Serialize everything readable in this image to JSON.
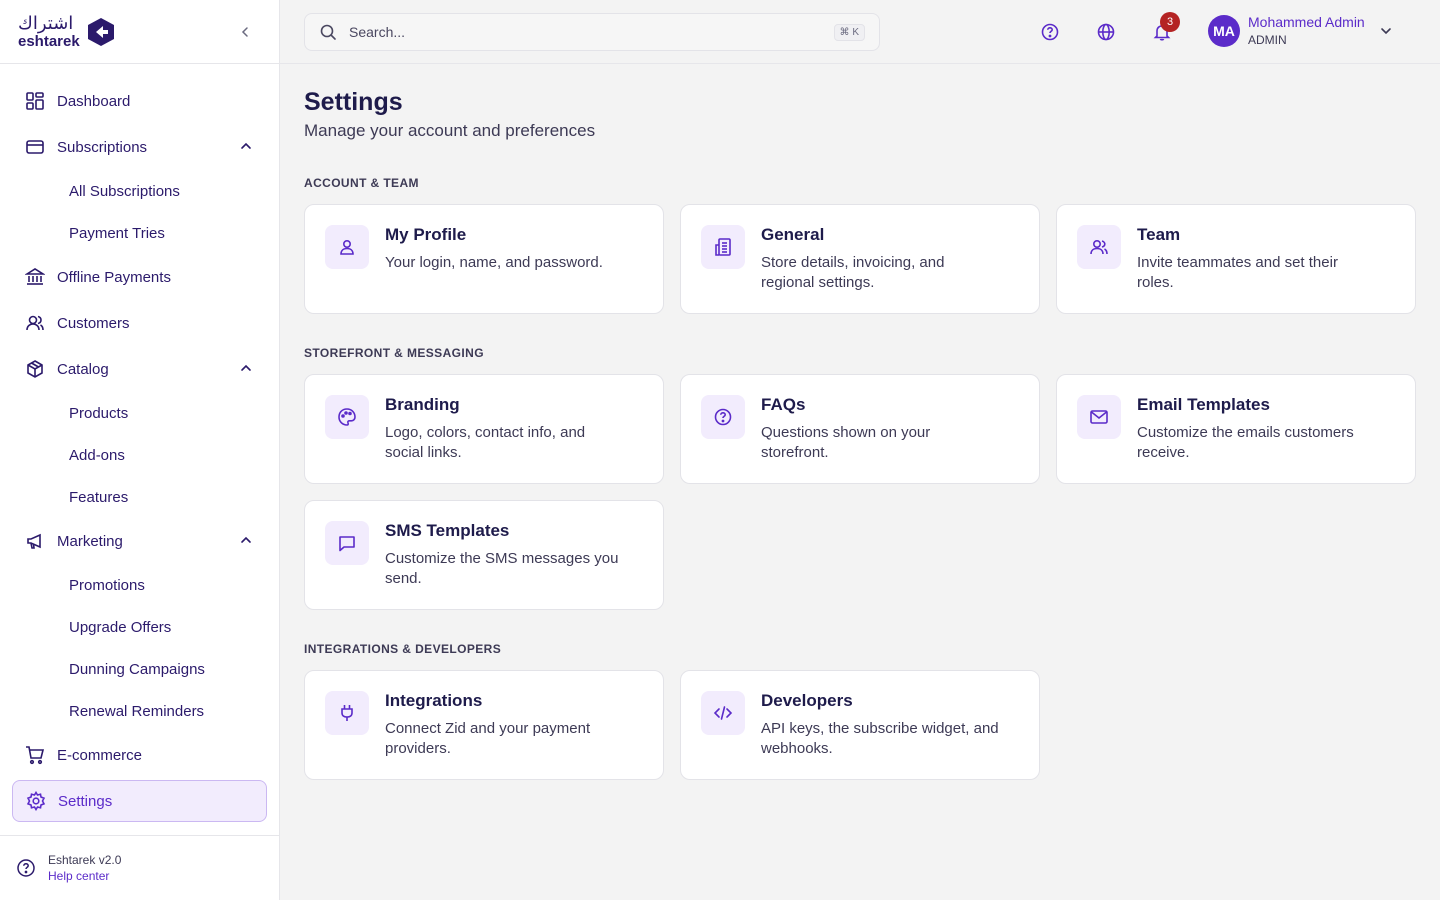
{
  "brand": {
    "name_ar": "اشتراك",
    "name_en": "eshtarek"
  },
  "sidebar": {
    "items": [
      {
        "label": "Dashboard"
      },
      {
        "label": "Subscriptions",
        "children": [
          "All Subscriptions",
          "Payment Tries"
        ]
      },
      {
        "label": "Offline Payments"
      },
      {
        "label": "Customers"
      },
      {
        "label": "Catalog",
        "children": [
          "Products",
          "Add-ons",
          "Features"
        ]
      },
      {
        "label": "Marketing",
        "children": [
          "Promotions",
          "Upgrade Offers",
          "Dunning Campaigns",
          "Renewal Reminders"
        ]
      },
      {
        "label": "E-commerce"
      },
      {
        "label": "Settings",
        "active": true
      }
    ],
    "footer": {
      "version": "Eshtarek v2.0",
      "help": "Help center"
    }
  },
  "topbar": {
    "search_placeholder": "Search...",
    "shortcut": "⌘ K",
    "notification_count": "3",
    "user": {
      "initials": "MA",
      "name": "Mohammed Admin",
      "role": "ADMIN"
    }
  },
  "page": {
    "title": "Settings",
    "subtitle": "Manage your account and preferences",
    "sections": [
      {
        "label": "ACCOUNT & TEAM",
        "cards": [
          {
            "title": "My Profile",
            "desc": "Your login, name, and password.",
            "icon": "user-icon"
          },
          {
            "title": "General",
            "desc": "Store details, invoicing, and regional settings.",
            "icon": "building-icon"
          },
          {
            "title": "Team",
            "desc": "Invite teammates and set their roles.",
            "icon": "users-icon"
          }
        ]
      },
      {
        "label": "STOREFRONT & MESSAGING",
        "cards": [
          {
            "title": "Branding",
            "desc": "Logo, colors, contact info, and social links.",
            "icon": "palette-icon"
          },
          {
            "title": "FAQs",
            "desc": "Questions shown on your storefront.",
            "icon": "help-circle-icon"
          },
          {
            "title": "Email Templates",
            "desc": "Customize the emails customers receive.",
            "icon": "mail-icon"
          },
          {
            "title": "SMS Templates",
            "desc": "Customize the SMS messages you send.",
            "icon": "message-square-icon"
          }
        ]
      },
      {
        "label": "INTEGRATIONS & DEVELOPERS",
        "cards": [
          {
            "title": "Integrations",
            "desc": "Connect Zid and your payment providers.",
            "icon": "plug-icon"
          },
          {
            "title": "Developers",
            "desc": "API keys, the subscribe widget, and webhooks.",
            "icon": "code-icon"
          }
        ]
      }
    ]
  },
  "colors": {
    "accent": "#5b2bc9",
    "navy": "#1e1b4b",
    "badge": "#b42323",
    "active_bg": "#f2ecfd"
  }
}
